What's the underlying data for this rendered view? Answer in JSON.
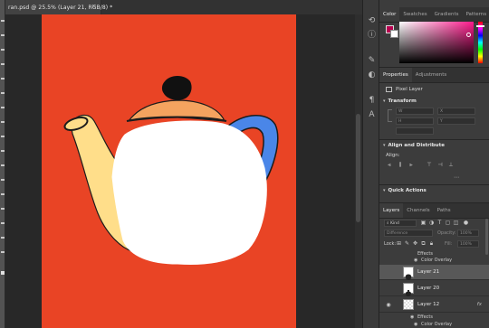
{
  "document": {
    "tab_title": "ran.psd @ 25.5% (Layer 21, RGB/8) *",
    "close_glyph": "×"
  },
  "colors": {
    "canvas_background": "#e94425",
    "foreground_swatch": "#b7004f",
    "background_swatch": "#ffffff",
    "teapot_body": "#ffffff",
    "teapot_lid": "#f4a35f",
    "teapot_knob": "#111111",
    "teapot_spout": "#ffde8a",
    "teapot_handle": "#4a86e8"
  },
  "right_strip_icons": [
    "history-icon",
    "info-icon",
    "brush-icon",
    "adjust-icon",
    "paragraph-icon",
    "character-icon"
  ],
  "color_panel": {
    "tabs": [
      "Color",
      "Swatches",
      "Gradients",
      "Patterns"
    ],
    "active_tab": "Color"
  },
  "properties_panel": {
    "tabs": [
      "Properties",
      "Adjustments"
    ],
    "active_tab": "Properties",
    "layer_type_label": "Pixel Layer",
    "transform": {
      "title": "Transform",
      "fields": [
        {
          "label": "W",
          "value": ""
        },
        {
          "label": "H",
          "value": ""
        },
        {
          "label": "X",
          "value": ""
        },
        {
          "label": "Y",
          "value": ""
        },
        {
          "label": "",
          "value": ""
        }
      ]
    },
    "align": {
      "title": "Align and Distribute",
      "subtitle": "Align:"
    },
    "quick_actions": {
      "title": "Quick Actions"
    }
  },
  "layers_panel": {
    "tabs": [
      "Layers",
      "Channels",
      "Paths"
    ],
    "active_tab": "Layers",
    "filter_label": "Kind",
    "blend_mode": "Difference",
    "opacity_label": "Opacity:",
    "opacity_value": "100%",
    "lock_label": "Lock:",
    "fill_label": "Fill:",
    "fill_value": "100%",
    "rows": [
      {
        "type": "sub",
        "text": "Effects"
      },
      {
        "type": "sub",
        "text": "Color Overlay"
      },
      {
        "type": "layer",
        "name": "Layer 21",
        "visible": false,
        "selected": true,
        "fx": false
      },
      {
        "type": "layer",
        "name": "Layer 20",
        "visible": false,
        "selected": false,
        "fx": false
      },
      {
        "type": "layer",
        "name": "Layer 12",
        "visible": true,
        "selected": false,
        "fx": true
      },
      {
        "type": "sub",
        "text": "Effects"
      },
      {
        "type": "sub",
        "text": "Color Overlay"
      }
    ],
    "fx_label": "fx"
  }
}
